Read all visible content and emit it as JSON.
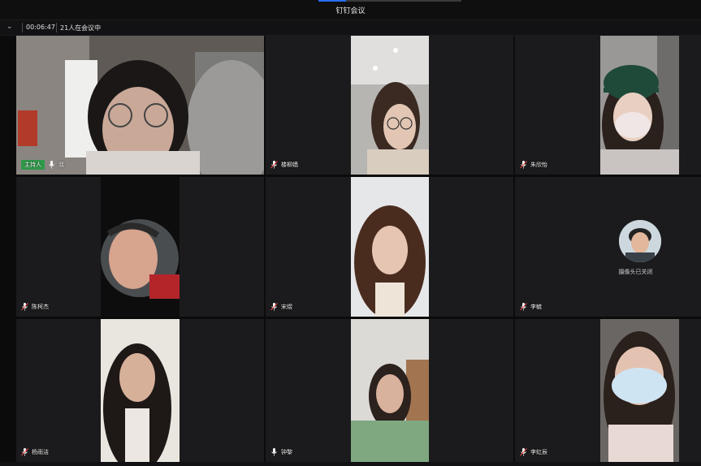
{
  "window": {
    "title": "钉钉会议"
  },
  "toolbar": {
    "timer": "00:06:47",
    "participants": "21人在会议中"
  },
  "tiles": [
    {
      "name": "我",
      "host_badge": "主持人",
      "mic": "on"
    },
    {
      "name": "楼柳嫱",
      "mic": "on"
    },
    {
      "name": "朱欣怡",
      "mic": "on"
    },
    {
      "name": "陈柯杰",
      "mic": "on"
    },
    {
      "name": "宋煜",
      "mic": "on"
    },
    {
      "name": "李毓",
      "mic": "on",
      "camera_status": "摄像头已关闭"
    },
    {
      "name": "杨雨洁",
      "mic": "on"
    },
    {
      "name": "钟黎",
      "mic": "on"
    },
    {
      "name": "李虹辰",
      "mic": "on"
    }
  ],
  "colors": {
    "accent": "#2a6df4",
    "host_badge": "#2e9a4a",
    "tile_bg": "#1b1b1d"
  }
}
